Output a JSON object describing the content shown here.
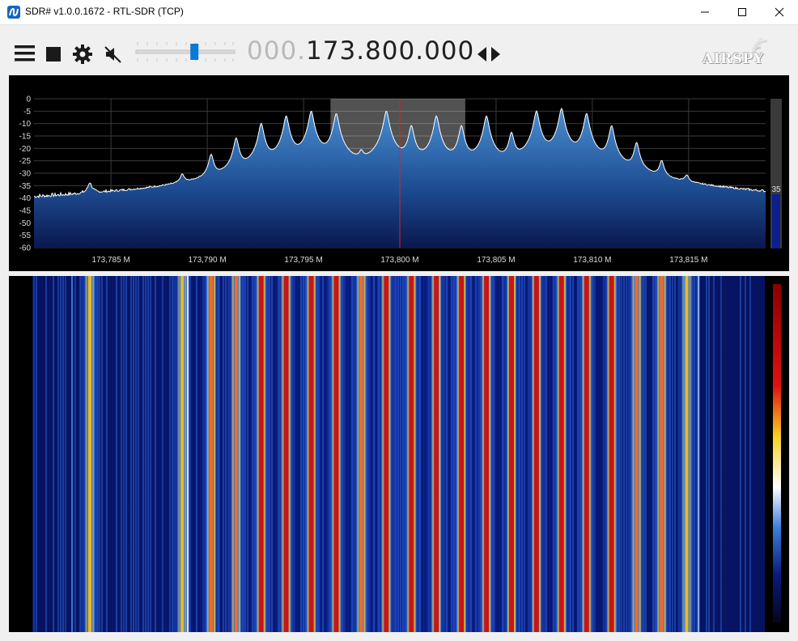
{
  "window": {
    "title": "SDR# v1.0.0.1672 - RTL-SDR (TCP)",
    "minimize_icon": "minimize-icon",
    "maximize_icon": "maximize-icon",
    "close_icon": "close-icon"
  },
  "toolbar": {
    "menu_icon": "hamburger-menu-icon",
    "stop_icon": "stop-icon",
    "settings_icon": "gear-icon",
    "mute_icon": "speaker-muted-icon",
    "frequency_prefix": "000.",
    "frequency_value": "173.800.000",
    "tune_icon": "left-right-arrows-icon",
    "logo_text": "AIRSPY",
    "audio_gain": 0.6
  },
  "spectrum": {
    "y_ticks": [
      "0",
      "-5",
      "-10",
      "-15",
      "-20",
      "-25",
      "-30",
      "-35",
      "-40",
      "-45",
      "-50",
      "-55",
      "-60"
    ],
    "x_ticks": [
      "173,785 M",
      "173,790 M",
      "173,795 M",
      "173,800 M",
      "173,805 M",
      "173,810 M",
      "173,815 M"
    ],
    "level_value": "35",
    "colors": {
      "trace": "#ffffff",
      "fill_top": "#3f86c8",
      "fill_bottom": "#0b1a4a",
      "center_line": "#e02020",
      "grid": "#3a3a3a",
      "level_bar": "#0d1f8f"
    }
  },
  "chart_data": {
    "type": "line",
    "title": "",
    "xlabel": "",
    "ylabel": "",
    "xlim": [
      173.781,
      173.819
    ],
    "ylim": [
      -60,
      0
    ],
    "x_unit": "MHz",
    "center_frequency": 173.8,
    "filter_band": [
      173.7964,
      173.8034
    ],
    "noise_floor": -46,
    "peaks": [
      {
        "x": 173.7839,
        "y": -36
      },
      {
        "x": 173.7887,
        "y": -33
      },
      {
        "x": 173.7902,
        "y": -23
      },
      {
        "x": 173.7915,
        "y": -16
      },
      {
        "x": 173.7928,
        "y": -10
      },
      {
        "x": 173.7941,
        "y": -7
      },
      {
        "x": 173.7954,
        "y": -5
      },
      {
        "x": 173.7967,
        "y": -6
      },
      {
        "x": 173.798,
        "y": -24
      },
      {
        "x": 173.7993,
        "y": -5
      },
      {
        "x": 173.8006,
        "y": -11
      },
      {
        "x": 173.8019,
        "y": -7
      },
      {
        "x": 173.8032,
        "y": -11
      },
      {
        "x": 173.8045,
        "y": -7
      },
      {
        "x": 173.8058,
        "y": -14
      },
      {
        "x": 173.8071,
        "y": -5
      },
      {
        "x": 173.8084,
        "y": -4
      },
      {
        "x": 173.8097,
        "y": -6
      },
      {
        "x": 173.811,
        "y": -11
      },
      {
        "x": 173.8123,
        "y": -18
      },
      {
        "x": 173.8136,
        "y": -26
      },
      {
        "x": 173.8149,
        "y": -34
      }
    ]
  },
  "waterfall": {
    "colors": {
      "background": "#0a1870",
      "hot": "#d01010",
      "warm": "#f0c020",
      "scale_top": "#8a0000",
      "scale_bottom": "#050520"
    }
  }
}
